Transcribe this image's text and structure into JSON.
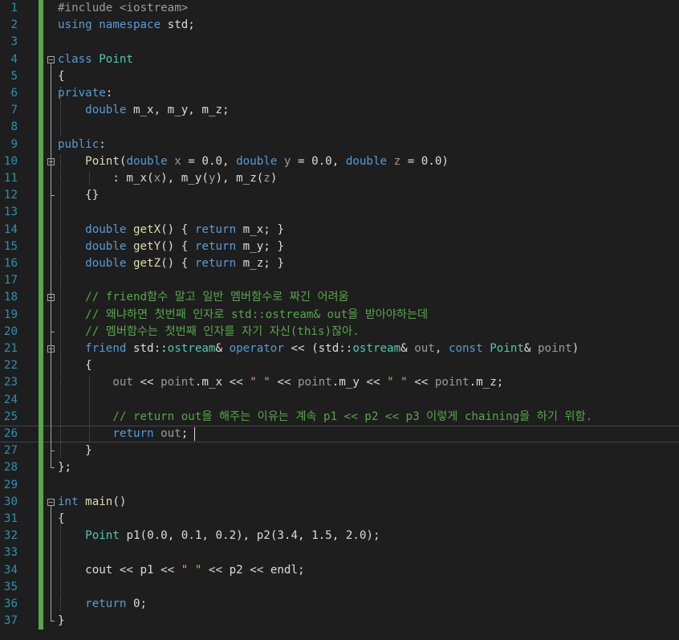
{
  "editor": {
    "current_line": 26,
    "lines": [
      {
        "n": "1",
        "tokens": [
          {
            "t": "#include <iostream>",
            "c": "mac"
          }
        ]
      },
      {
        "n": "2",
        "tokens": [
          {
            "t": "using",
            "c": "kw"
          },
          {
            "t": " "
          },
          {
            "t": "namespace",
            "c": "kw"
          },
          {
            "t": " std;"
          }
        ]
      },
      {
        "n": "3",
        "tokens": []
      },
      {
        "n": "4",
        "tokens": [
          {
            "t": "class",
            "c": "kw"
          },
          {
            "t": " "
          },
          {
            "t": "Point",
            "c": "ty"
          }
        ]
      },
      {
        "n": "5",
        "tokens": [
          {
            "t": "{"
          }
        ]
      },
      {
        "n": "6",
        "tokens": [
          {
            "t": "private",
            "c": "kw"
          },
          {
            "t": ":"
          }
        ]
      },
      {
        "n": "7",
        "tokens": [
          {
            "t": "    "
          },
          {
            "t": "double",
            "c": "kw"
          },
          {
            "t": " m_x, m_y, m_z;"
          }
        ]
      },
      {
        "n": "8",
        "tokens": []
      },
      {
        "n": "9",
        "tokens": [
          {
            "t": "public",
            "c": "kw"
          },
          {
            "t": ":"
          }
        ]
      },
      {
        "n": "10",
        "tokens": [
          {
            "t": "    "
          },
          {
            "t": "Point",
            "c": "fn"
          },
          {
            "t": "("
          },
          {
            "t": "double",
            "c": "kw"
          },
          {
            "t": " "
          },
          {
            "t": "x",
            "c": "par"
          },
          {
            "t": " = 0.0, "
          },
          {
            "t": "double",
            "c": "kw"
          },
          {
            "t": " "
          },
          {
            "t": "y",
            "c": "par"
          },
          {
            "t": " = 0.0, "
          },
          {
            "t": "double",
            "c": "kw"
          },
          {
            "t": " "
          },
          {
            "t": "z",
            "c": "par"
          },
          {
            "t": " = 0.0)"
          }
        ]
      },
      {
        "n": "11",
        "tokens": [
          {
            "t": "        : m_x("
          },
          {
            "t": "x",
            "c": "par"
          },
          {
            "t": "), m_y("
          },
          {
            "t": "y",
            "c": "par"
          },
          {
            "t": "), m_z("
          },
          {
            "t": "z",
            "c": "par"
          },
          {
            "t": ")"
          }
        ]
      },
      {
        "n": "12",
        "tokens": [
          {
            "t": "    {}"
          }
        ]
      },
      {
        "n": "13",
        "tokens": []
      },
      {
        "n": "14",
        "tokens": [
          {
            "t": "    "
          },
          {
            "t": "double",
            "c": "kw"
          },
          {
            "t": " "
          },
          {
            "t": "getX",
            "c": "fn"
          },
          {
            "t": "() { "
          },
          {
            "t": "return",
            "c": "kw"
          },
          {
            "t": " m_x; }"
          }
        ]
      },
      {
        "n": "15",
        "tokens": [
          {
            "t": "    "
          },
          {
            "t": "double",
            "c": "kw"
          },
          {
            "t": " "
          },
          {
            "t": "getY",
            "c": "fn"
          },
          {
            "t": "() { "
          },
          {
            "t": "return",
            "c": "kw"
          },
          {
            "t": " m_y; }"
          }
        ]
      },
      {
        "n": "16",
        "tokens": [
          {
            "t": "    "
          },
          {
            "t": "double",
            "c": "kw"
          },
          {
            "t": " "
          },
          {
            "t": "getZ",
            "c": "fn"
          },
          {
            "t": "() { "
          },
          {
            "t": "return",
            "c": "kw"
          },
          {
            "t": " m_z; }"
          }
        ]
      },
      {
        "n": "17",
        "tokens": []
      },
      {
        "n": "18",
        "tokens": [
          {
            "t": "    "
          },
          {
            "t": "// friend함수 말고 일반 멤버함수로 짜긴 어려움",
            "c": "cm"
          }
        ]
      },
      {
        "n": "19",
        "tokens": [
          {
            "t": "    "
          },
          {
            "t": "// 왜냐하면 첫번째 인자로 std::ostream& out을 받아야하는데",
            "c": "cm"
          }
        ]
      },
      {
        "n": "20",
        "tokens": [
          {
            "t": "    "
          },
          {
            "t": "// 멤버함수는 첫번째 인자를 자기 자신(this)잖아.",
            "c": "cm"
          }
        ]
      },
      {
        "n": "21",
        "tokens": [
          {
            "t": "    "
          },
          {
            "t": "friend",
            "c": "kw"
          },
          {
            "t": " std::"
          },
          {
            "t": "ostream",
            "c": "ty"
          },
          {
            "t": "& "
          },
          {
            "t": "operator",
            "c": "kw"
          },
          {
            "t": " << (std::"
          },
          {
            "t": "ostream",
            "c": "ty"
          },
          {
            "t": "& "
          },
          {
            "t": "out",
            "c": "par"
          },
          {
            "t": ", "
          },
          {
            "t": "const",
            "c": "kw"
          },
          {
            "t": " "
          },
          {
            "t": "Point",
            "c": "ty"
          },
          {
            "t": "& "
          },
          {
            "t": "point",
            "c": "par"
          },
          {
            "t": ")"
          }
        ]
      },
      {
        "n": "22",
        "tokens": [
          {
            "t": "    {"
          }
        ]
      },
      {
        "n": "23",
        "tokens": [
          {
            "t": "        "
          },
          {
            "t": "out",
            "c": "par"
          },
          {
            "t": " << "
          },
          {
            "t": "point",
            "c": "par"
          },
          {
            "t": ".m_x << "
          },
          {
            "t": "\" \"",
            "c": "str"
          },
          {
            "t": " << "
          },
          {
            "t": "point",
            "c": "par"
          },
          {
            "t": ".m_y << "
          },
          {
            "t": "\" \"",
            "c": "str"
          },
          {
            "t": " << "
          },
          {
            "t": "point",
            "c": "par"
          },
          {
            "t": ".m_z;"
          }
        ]
      },
      {
        "n": "24",
        "tokens": []
      },
      {
        "n": "25",
        "tokens": [
          {
            "t": "        "
          },
          {
            "t": "// return out을 해주는 이유는 계속 p1 << p2 << p3 이렇게 chaining을 하기 위함.",
            "c": "cm"
          }
        ]
      },
      {
        "n": "26",
        "tokens": [
          {
            "t": "        "
          },
          {
            "t": "return",
            "c": "kw"
          },
          {
            "t": " "
          },
          {
            "t": "out",
            "c": "par"
          },
          {
            "t": ";"
          }
        ]
      },
      {
        "n": "27",
        "tokens": [
          {
            "t": "    }"
          }
        ]
      },
      {
        "n": "28",
        "tokens": [
          {
            "t": "};"
          }
        ]
      },
      {
        "n": "29",
        "tokens": []
      },
      {
        "n": "30",
        "tokens": [
          {
            "t": "int",
            "c": "kw"
          },
          {
            "t": " "
          },
          {
            "t": "main",
            "c": "fn"
          },
          {
            "t": "()"
          }
        ]
      },
      {
        "n": "31",
        "tokens": [
          {
            "t": "{"
          }
        ]
      },
      {
        "n": "32",
        "tokens": [
          {
            "t": "    "
          },
          {
            "t": "Point",
            "c": "ty"
          },
          {
            "t": " "
          },
          {
            "t": "p1",
            "c": "mv"
          },
          {
            "t": "(0.0, 0.1, 0.2), "
          },
          {
            "t": "p2",
            "c": "mv"
          },
          {
            "t": "(3.4, 1.5, 2.0);"
          }
        ]
      },
      {
        "n": "33",
        "tokens": []
      },
      {
        "n": "34",
        "tokens": [
          {
            "t": "    cout << "
          },
          {
            "t": "p1",
            "c": "mv"
          },
          {
            "t": " << "
          },
          {
            "t": "\" \"",
            "c": "str"
          },
          {
            "t": " << "
          },
          {
            "t": "p2",
            "c": "mv"
          },
          {
            "t": " << endl;"
          }
        ]
      },
      {
        "n": "35",
        "tokens": []
      },
      {
        "n": "36",
        "tokens": [
          {
            "t": "    "
          },
          {
            "t": "return",
            "c": "kw"
          },
          {
            "t": " 0;"
          }
        ]
      },
      {
        "n": "37",
        "tokens": [
          {
            "t": "}"
          }
        ]
      }
    ]
  },
  "colors": {
    "background": "#1e1e1e",
    "line_number": "#2b91af",
    "keyword": "#569cd6",
    "type": "#4ec9b0",
    "function": "#dcdcaa",
    "comment": "#57a64a",
    "string": "#d69d85",
    "change_bar": "#57a64a"
  }
}
